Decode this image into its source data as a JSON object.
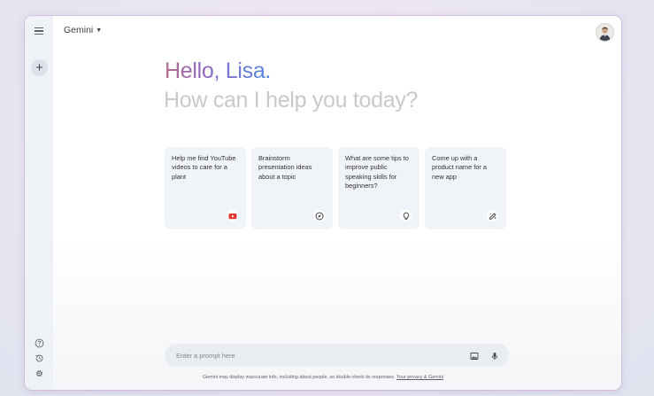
{
  "app": {
    "title": "Gemini"
  },
  "greeting": {
    "hello": "Hello, Lisa.",
    "subtitle": "How can I help you today?"
  },
  "cards": [
    {
      "text": "Help me find YouTube videos to care for a plant",
      "icon": "youtube-icon"
    },
    {
      "text": "Brainstorm presentation ideas about a topic",
      "icon": "compass-icon"
    },
    {
      "text": "What are some tips to improve public speaking skills for beginners?",
      "icon": "lightbulb-icon"
    },
    {
      "text": "Come up with a product name for a new app",
      "icon": "pen-sparkle-icon"
    }
  ],
  "prompt": {
    "placeholder": "Enter a prompt here"
  },
  "footer": {
    "disclaimer": "Gemini may display inaccurate info, including about people, so double-check its responses.",
    "link": "Your privacy & Gemini"
  },
  "colors": {
    "sidebar_bg": "#eef1f6",
    "card_bg": "#f0f4f9",
    "youtube_red": "#e53935",
    "greeting_gradient_start": "#b56b8e",
    "greeting_gradient_end": "#4f86e4"
  }
}
